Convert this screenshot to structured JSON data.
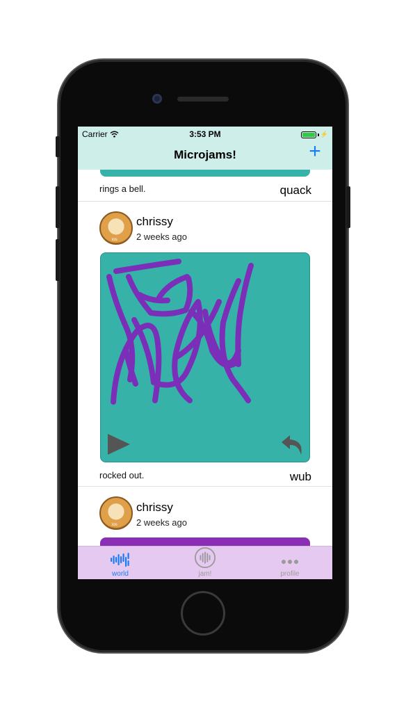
{
  "status_bar": {
    "carrier": "Carrier",
    "time": "3:53 PM"
  },
  "nav": {
    "title": "Microjams!",
    "add_label": "+"
  },
  "feed": {
    "previous_item": {
      "caption": "rings a bell.",
      "sound": "quack"
    },
    "items": [
      {
        "username": "chrissy",
        "time_ago": "2 weeks ago",
        "avatar_badge": "ios",
        "caption": "rocked out.",
        "sound": "wub",
        "jam_color": "#36b2a8",
        "stroke_color": "#7b2fb8"
      },
      {
        "username": "chrissy",
        "time_ago": "2 weeks ago",
        "avatar_badge": "ios",
        "jam_color": "#8a2fb5"
      }
    ]
  },
  "tabbar": {
    "tabs": [
      {
        "label": "world",
        "icon": "world-icon",
        "active": true
      },
      {
        "label": "jam!",
        "icon": "jam-icon",
        "active": false
      },
      {
        "label": "profile",
        "icon": "profile-icon",
        "active": false
      }
    ]
  },
  "colors": {
    "nav_background": "#cdeee9",
    "tab_background": "#e6c9f0",
    "accent": "#1a7cf5",
    "jam_teal": "#36b2a8",
    "stroke_purple": "#7b2fb8"
  }
}
